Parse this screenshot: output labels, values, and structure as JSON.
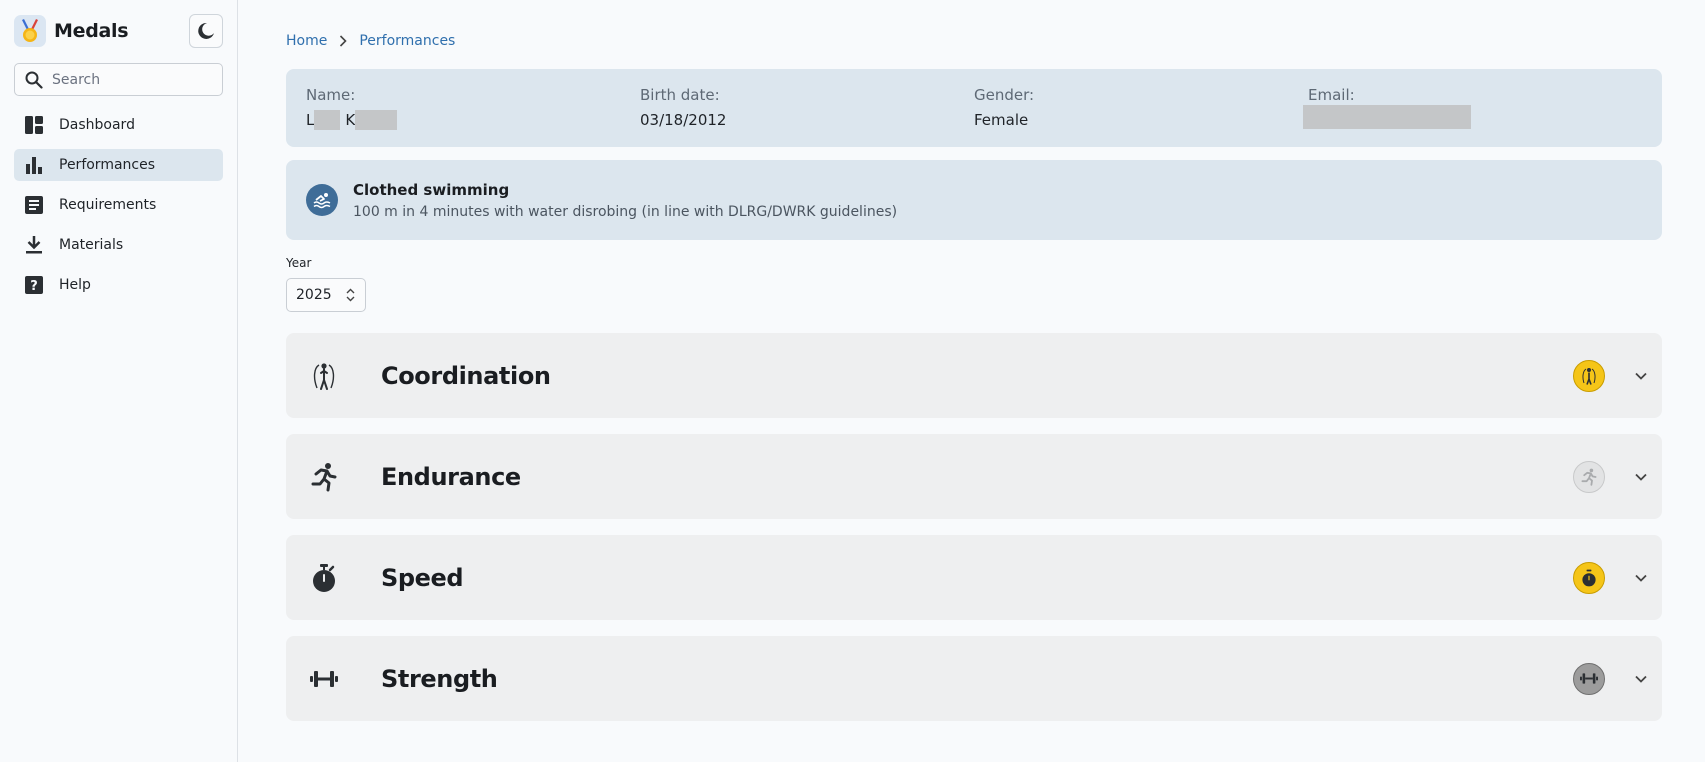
{
  "app": {
    "title": "Medals"
  },
  "search": {
    "placeholder": "Search"
  },
  "sidebar": {
    "items": [
      {
        "label": "Dashboard",
        "icon": "dashboard-icon",
        "active": false
      },
      {
        "label": "Performances",
        "icon": "bar-chart-icon",
        "active": true
      },
      {
        "label": "Requirements",
        "icon": "list-icon",
        "active": false
      },
      {
        "label": "Materials",
        "icon": "download-icon",
        "active": false
      },
      {
        "label": "Help",
        "icon": "help-icon",
        "active": false
      }
    ]
  },
  "breadcrumb": {
    "home": "Home",
    "current": "Performances"
  },
  "profile": {
    "name_label": "Name:",
    "name_first_initial": "L",
    "name_last_initial": "K",
    "birth_label": "Birth date:",
    "birth_value": "03/18/2012",
    "gender_label": "Gender:",
    "gender_value": "Female",
    "email_label": "Email:"
  },
  "event": {
    "title": "Clothed swimming",
    "description": "100 m in 4 minutes with water disrobing (in line with DLRG/DWRK guidelines)"
  },
  "year": {
    "label": "Year",
    "value": "2025"
  },
  "categories": [
    {
      "title": "Coordination",
      "icon": "jump-rope-icon",
      "badge_color": "#f5c518",
      "badge_status": "gold"
    },
    {
      "title": "Endurance",
      "icon": "running-icon",
      "badge_color": "#e2e3e4",
      "badge_status": "none"
    },
    {
      "title": "Speed",
      "icon": "stopwatch-icon",
      "badge_color": "#f5c518",
      "badge_status": "gold"
    },
    {
      "title": "Strength",
      "icon": "dumbbell-icon",
      "badge_color": "#9c9c9c",
      "badge_status": "silver"
    }
  ],
  "colors": {
    "accent": "#2f6fad",
    "active_nav": "#dce6ee",
    "panel": "#dce6ee",
    "card": "#eeeff0",
    "gold": "#f5c518"
  }
}
